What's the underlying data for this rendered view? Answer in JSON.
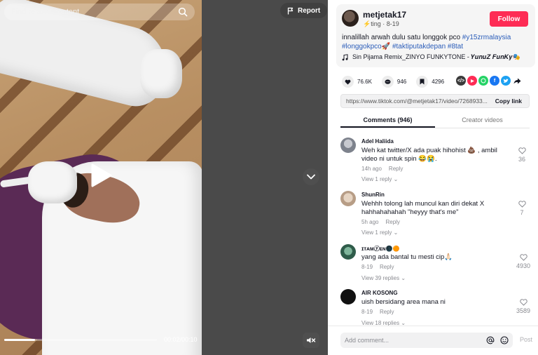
{
  "search": {
    "placeholder": "Find related content",
    "icon": "search-icon"
  },
  "video": {
    "report_label": "Report",
    "time": "00:02/00:10",
    "progress": 0.2,
    "play_icon": "play-icon",
    "mute_icon": "mute-icon"
  },
  "author": {
    "username": "metjetak17",
    "subline": "⚡ting · 8-19",
    "follow_label": "Follow"
  },
  "caption": {
    "text": "innalillah arwah dulu satu longgok pco ",
    "tags": [
      "#y15zrmalaysia",
      "#longgokpco🚀",
      "#taktiputakdepan",
      "#8tat"
    ]
  },
  "music": {
    "title": "Sin Pijama Remix_ZINYO FUNKYTONE - 𝒀𝒖𝒏𝒖𝒁 𝑭𝒖𝒏𝑲𝒚🎭"
  },
  "stats": {
    "likes": "76.6K",
    "comments": "946",
    "saves": "4296"
  },
  "share": [
    "embed",
    "pinterest",
    "whatsapp",
    "facebook",
    "twitter",
    "forward"
  ],
  "link": {
    "url": "https://www.tiktok.com/@metjetak17/video/7268933...",
    "copy_label": "Copy link"
  },
  "tabs": [
    {
      "label": "Comments (946)",
      "active": true
    },
    {
      "label": "Creator videos",
      "active": false
    }
  ],
  "comments": [
    {
      "name": "Adel Haliida",
      "text": "Weh kat twitter/X ada puak hihohist 💩 , ambil video ni untuk spin 😂😭.",
      "time": "14h ago",
      "reply": "Reply",
      "view": "View 1 reply ⌄",
      "likes": "36",
      "avatar_color": "#8a8f99"
    },
    {
      "name": "ShunRin",
      "text": "Wehhh tolong lah muncul kan diri dekat X hahhahahahah \"heyyy that's me\"",
      "time": "5h ago",
      "reply": "Reply",
      "view": "View 1 reply ⌄",
      "likes": "7",
      "avatar_color": "#c9b3a0"
    },
    {
      "name": "ɪᴛᴀᴍⓨᴇɴ🌑🟠",
      "text": "yang ada bantal tu mesti cip🙏🏻",
      "time": "8-19",
      "reply": "Reply",
      "view": "View 39 replies ⌄",
      "likes": "4930",
      "avatar_color": "#3c6e5a"
    },
    {
      "name": "AIR KOSONG",
      "text": "uish bersidang area mana ni",
      "time": "8-19",
      "reply": "Reply",
      "view": "View 18 replies ⌄",
      "likes": "3589",
      "avatar_color": "#111111"
    }
  ],
  "add_comment": {
    "placeholder": "Add comment...",
    "post_label": "Post"
  },
  "colors": {
    "brand": "#fe2c55",
    "tag": "#2b5db9"
  }
}
